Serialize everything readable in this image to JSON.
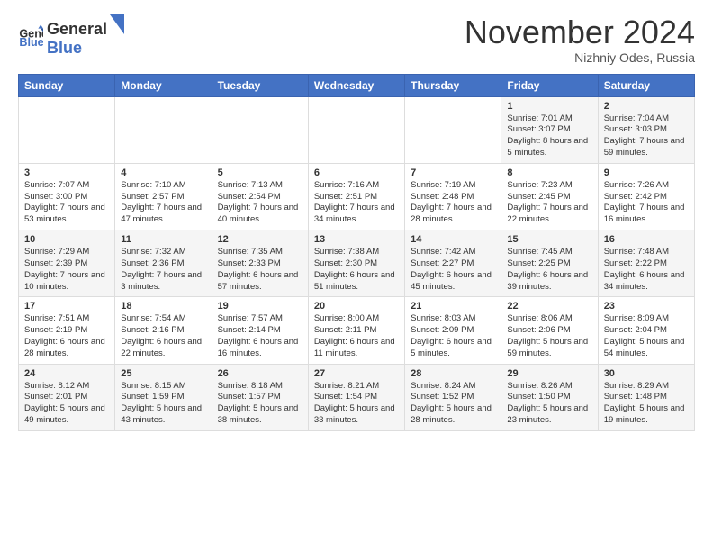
{
  "logo": {
    "general": "General",
    "blue": "Blue"
  },
  "header": {
    "month": "November 2024",
    "location": "Nizhniy Odes, Russia"
  },
  "weekdays": [
    "Sunday",
    "Monday",
    "Tuesday",
    "Wednesday",
    "Thursday",
    "Friday",
    "Saturday"
  ],
  "weeks": [
    [
      {
        "day": "",
        "info": ""
      },
      {
        "day": "",
        "info": ""
      },
      {
        "day": "",
        "info": ""
      },
      {
        "day": "",
        "info": ""
      },
      {
        "day": "",
        "info": ""
      },
      {
        "day": "1",
        "info": "Sunrise: 7:01 AM\nSunset: 3:07 PM\nDaylight: 8 hours\nand 5 minutes."
      },
      {
        "day": "2",
        "info": "Sunrise: 7:04 AM\nSunset: 3:03 PM\nDaylight: 7 hours\nand 59 minutes."
      }
    ],
    [
      {
        "day": "3",
        "info": "Sunrise: 7:07 AM\nSunset: 3:00 PM\nDaylight: 7 hours\nand 53 minutes."
      },
      {
        "day": "4",
        "info": "Sunrise: 7:10 AM\nSunset: 2:57 PM\nDaylight: 7 hours\nand 47 minutes."
      },
      {
        "day": "5",
        "info": "Sunrise: 7:13 AM\nSunset: 2:54 PM\nDaylight: 7 hours\nand 40 minutes."
      },
      {
        "day": "6",
        "info": "Sunrise: 7:16 AM\nSunset: 2:51 PM\nDaylight: 7 hours\nand 34 minutes."
      },
      {
        "day": "7",
        "info": "Sunrise: 7:19 AM\nSunset: 2:48 PM\nDaylight: 7 hours\nand 28 minutes."
      },
      {
        "day": "8",
        "info": "Sunrise: 7:23 AM\nSunset: 2:45 PM\nDaylight: 7 hours\nand 22 minutes."
      },
      {
        "day": "9",
        "info": "Sunrise: 7:26 AM\nSunset: 2:42 PM\nDaylight: 7 hours\nand 16 minutes."
      }
    ],
    [
      {
        "day": "10",
        "info": "Sunrise: 7:29 AM\nSunset: 2:39 PM\nDaylight: 7 hours\nand 10 minutes."
      },
      {
        "day": "11",
        "info": "Sunrise: 7:32 AM\nSunset: 2:36 PM\nDaylight: 7 hours\nand 3 minutes."
      },
      {
        "day": "12",
        "info": "Sunrise: 7:35 AM\nSunset: 2:33 PM\nDaylight: 6 hours\nand 57 minutes."
      },
      {
        "day": "13",
        "info": "Sunrise: 7:38 AM\nSunset: 2:30 PM\nDaylight: 6 hours\nand 51 minutes."
      },
      {
        "day": "14",
        "info": "Sunrise: 7:42 AM\nSunset: 2:27 PM\nDaylight: 6 hours\nand 45 minutes."
      },
      {
        "day": "15",
        "info": "Sunrise: 7:45 AM\nSunset: 2:25 PM\nDaylight: 6 hours\nand 39 minutes."
      },
      {
        "day": "16",
        "info": "Sunrise: 7:48 AM\nSunset: 2:22 PM\nDaylight: 6 hours\nand 34 minutes."
      }
    ],
    [
      {
        "day": "17",
        "info": "Sunrise: 7:51 AM\nSunset: 2:19 PM\nDaylight: 6 hours\nand 28 minutes."
      },
      {
        "day": "18",
        "info": "Sunrise: 7:54 AM\nSunset: 2:16 PM\nDaylight: 6 hours\nand 22 minutes."
      },
      {
        "day": "19",
        "info": "Sunrise: 7:57 AM\nSunset: 2:14 PM\nDaylight: 6 hours\nand 16 minutes."
      },
      {
        "day": "20",
        "info": "Sunrise: 8:00 AM\nSunset: 2:11 PM\nDaylight: 6 hours\nand 11 minutes."
      },
      {
        "day": "21",
        "info": "Sunrise: 8:03 AM\nSunset: 2:09 PM\nDaylight: 6 hours\nand 5 minutes."
      },
      {
        "day": "22",
        "info": "Sunrise: 8:06 AM\nSunset: 2:06 PM\nDaylight: 5 hours\nand 59 minutes."
      },
      {
        "day": "23",
        "info": "Sunrise: 8:09 AM\nSunset: 2:04 PM\nDaylight: 5 hours\nand 54 minutes."
      }
    ],
    [
      {
        "day": "24",
        "info": "Sunrise: 8:12 AM\nSunset: 2:01 PM\nDaylight: 5 hours\nand 49 minutes."
      },
      {
        "day": "25",
        "info": "Sunrise: 8:15 AM\nSunset: 1:59 PM\nDaylight: 5 hours\nand 43 minutes."
      },
      {
        "day": "26",
        "info": "Sunrise: 8:18 AM\nSunset: 1:57 PM\nDaylight: 5 hours\nand 38 minutes."
      },
      {
        "day": "27",
        "info": "Sunrise: 8:21 AM\nSunset: 1:54 PM\nDaylight: 5 hours\nand 33 minutes."
      },
      {
        "day": "28",
        "info": "Sunrise: 8:24 AM\nSunset: 1:52 PM\nDaylight: 5 hours\nand 28 minutes."
      },
      {
        "day": "29",
        "info": "Sunrise: 8:26 AM\nSunset: 1:50 PM\nDaylight: 5 hours\nand 23 minutes."
      },
      {
        "day": "30",
        "info": "Sunrise: 8:29 AM\nSunset: 1:48 PM\nDaylight: 5 hours\nand 19 minutes."
      }
    ]
  ]
}
